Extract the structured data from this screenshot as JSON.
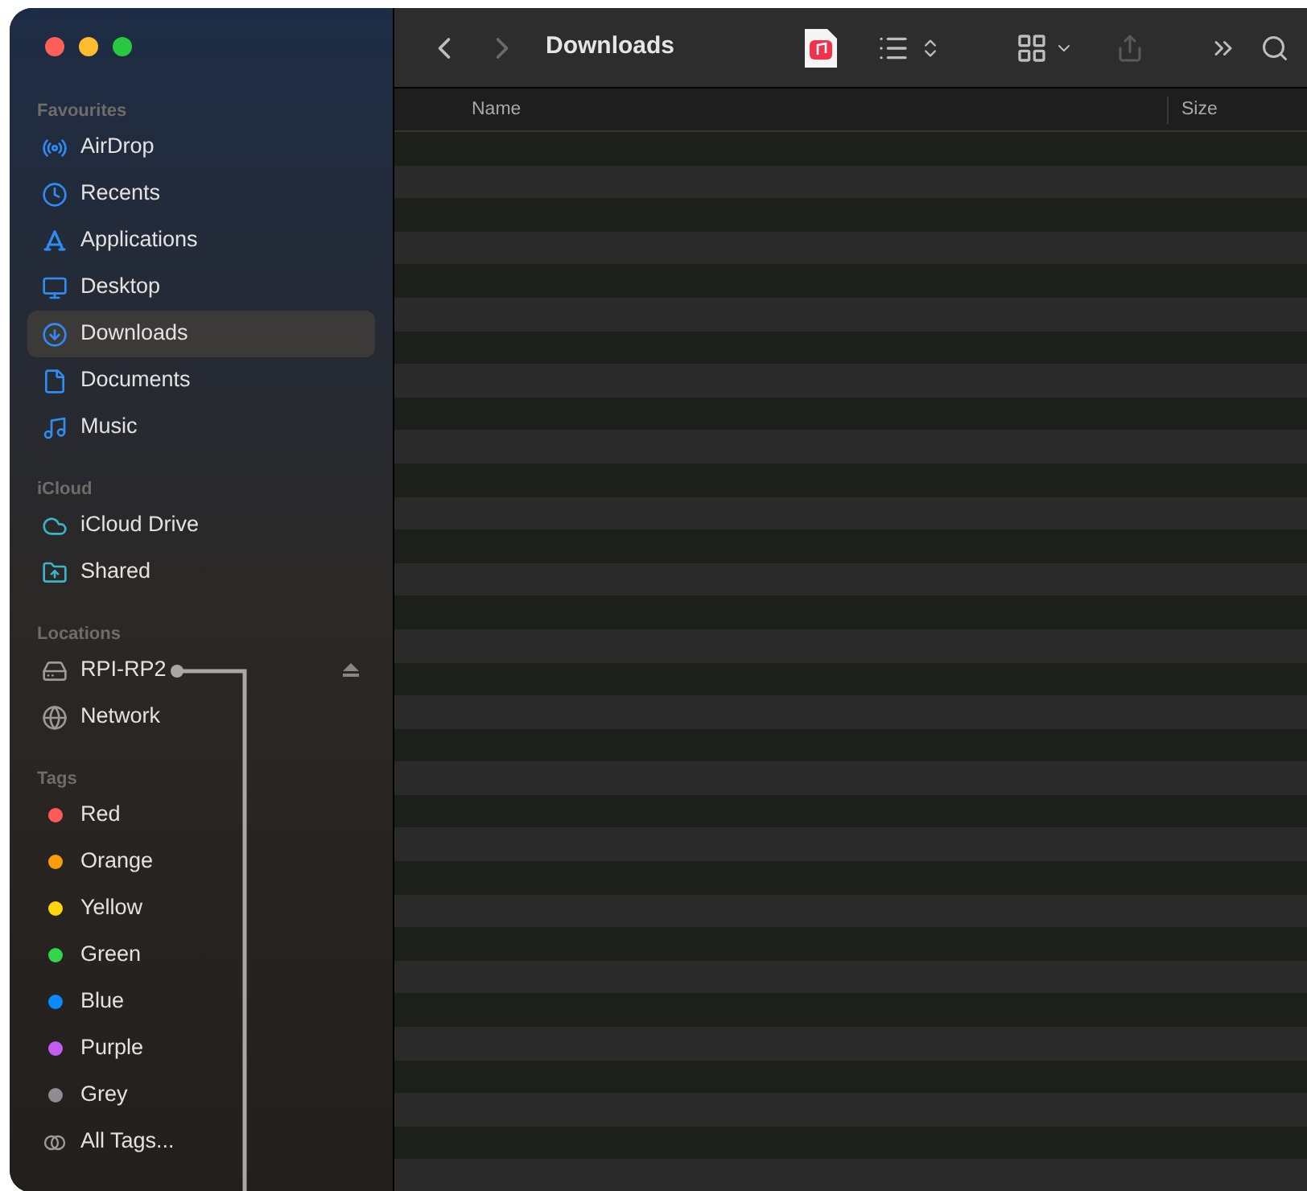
{
  "window": {
    "title": "Downloads"
  },
  "sidebar": {
    "sections": [
      {
        "heading": "Favourites",
        "items": [
          {
            "label": "AirDrop",
            "kind": "airdrop",
            "selected": false
          },
          {
            "label": "Recents",
            "kind": "recents",
            "selected": false
          },
          {
            "label": "Applications",
            "kind": "applications",
            "selected": false
          },
          {
            "label": "Desktop",
            "kind": "desktop",
            "selected": false
          },
          {
            "label": "Downloads",
            "kind": "downloads",
            "selected": true
          },
          {
            "label": "Documents",
            "kind": "documents",
            "selected": false
          },
          {
            "label": "Music",
            "kind": "music",
            "selected": false
          }
        ]
      },
      {
        "heading": "iCloud",
        "items": [
          {
            "label": "iCloud Drive",
            "kind": "cloud",
            "selected": false
          },
          {
            "label": "Shared",
            "kind": "shared",
            "selected": false
          }
        ]
      },
      {
        "heading": "Locations",
        "items": [
          {
            "label": "RPI-RP2",
            "kind": "drive",
            "selected": false,
            "ejectable": true
          },
          {
            "label": "Network",
            "kind": "network",
            "selected": false
          }
        ]
      },
      {
        "heading": "Tags",
        "items": [
          {
            "label": "Red",
            "kind": "tag",
            "color": "#fe5b57",
            "selected": false
          },
          {
            "label": "Orange",
            "kind": "tag",
            "color": "#fe9d0a",
            "selected": false
          },
          {
            "label": "Yellow",
            "kind": "tag",
            "color": "#fed60a",
            "selected": false
          },
          {
            "label": "Green",
            "kind": "tag",
            "color": "#32d64a",
            "selected": false
          },
          {
            "label": "Blue",
            "kind": "tag",
            "color": "#0a8bff",
            "selected": false
          },
          {
            "label": "Purple",
            "kind": "tag",
            "color": "#c55df0",
            "selected": false
          },
          {
            "label": "Grey",
            "kind": "tag",
            "color": "#8e8e92",
            "selected": false
          },
          {
            "label": "All Tags...",
            "kind": "alltags",
            "selected": false
          }
        ]
      }
    ]
  },
  "table": {
    "columns": [
      "Name",
      "Size"
    ]
  }
}
